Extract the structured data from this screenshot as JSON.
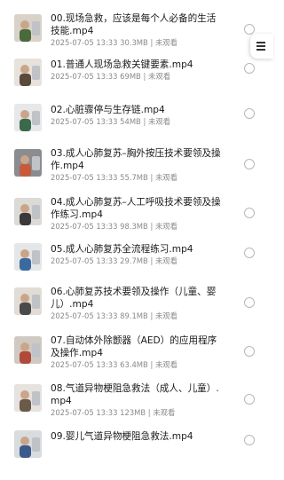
{
  "files": [
    {
      "title": "00.现场急救，应该是每个人必备的生活技能.mp4",
      "date": "2025-07-05 13:33",
      "size": "30.3MB",
      "status": "未观看"
    },
    {
      "title": "01.普通人现场急救关键要素.mp4",
      "date": "2025-07-05 13:33",
      "size": "69MB",
      "status": "未观看"
    },
    {
      "title": "02.心脏骤停与生存链.mp4",
      "date": "2025-07-05 13:33",
      "size": "54MB",
      "status": "未观看"
    },
    {
      "title": "03.成人心肺复苏–胸外按压技术要领及操作.mp4",
      "date": "2025-07-05 13:33",
      "size": "55.7MB",
      "status": "未观看"
    },
    {
      "title": "04.成人心肺复苏–人工呼吸技术要领及操作练习.mp4",
      "date": "2025-07-05 13:33",
      "size": "98.3MB",
      "status": "未观看"
    },
    {
      "title": "05.成人心肺复苏全流程练习.mp4",
      "date": "2025-07-05 13:33",
      "size": "29.7MB",
      "status": "未观看"
    },
    {
      "title": "06.心肺复苏技术要领及操作（儿童、婴儿）.mp4",
      "date": "2025-07-05 13:33",
      "size": "89.1MB",
      "status": "未观看"
    },
    {
      "title": "07.自动体外除颤器（AED）的应用程序及操作.mp4",
      "date": "2025-07-05 13:33",
      "size": "63.4MB",
      "status": "未观看"
    },
    {
      "title": "08.气道异物梗阻急救法（成人、儿童）.mp4",
      "date": "2025-07-05 13:33",
      "size": "123MB",
      "status": "未观看"
    },
    {
      "title": "09.婴儿气道异物梗阻急救法.mp4",
      "date": "",
      "size": "",
      "status": ""
    }
  ],
  "meta_separator": " | ",
  "icons": {
    "menu": "hamburger-icon",
    "select": "radio-circle-icon",
    "thumbnail": "video-thumbnail"
  }
}
